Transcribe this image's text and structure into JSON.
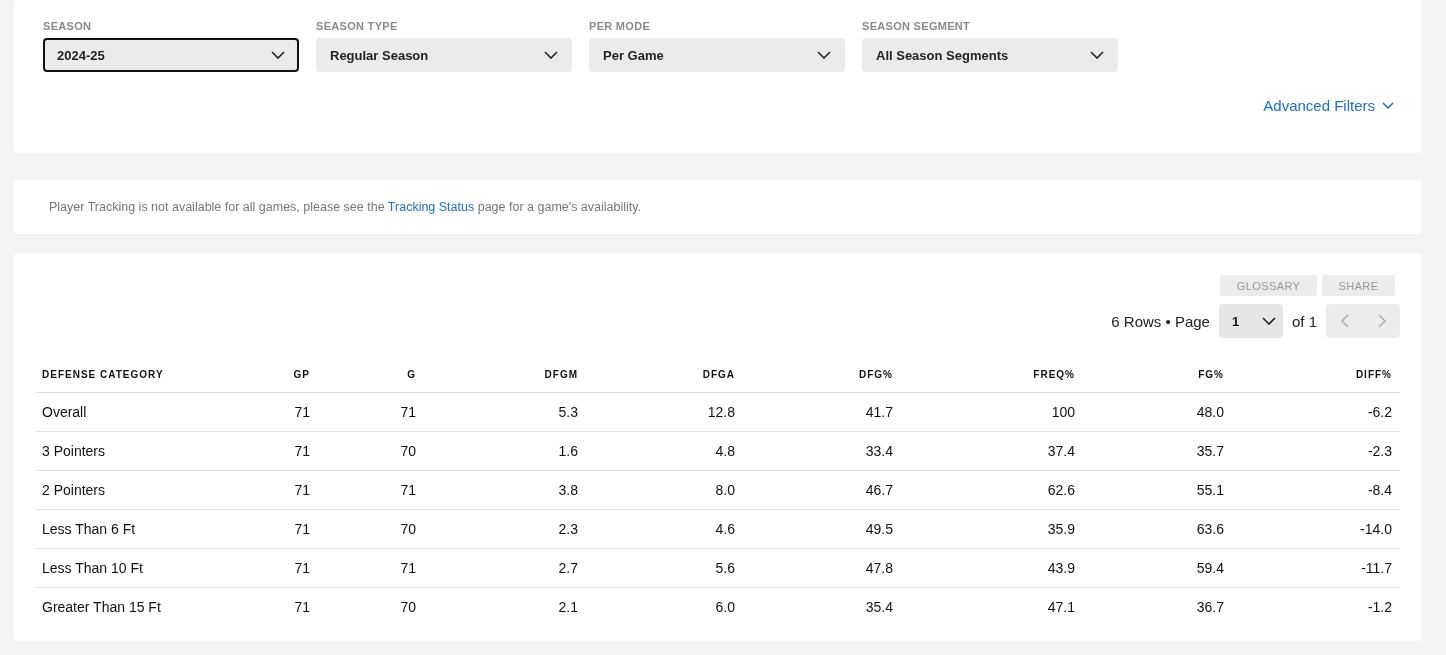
{
  "filters": [
    {
      "label": "SEASON",
      "value": "2024-25",
      "focused": true
    },
    {
      "label": "SEASON TYPE",
      "value": "Regular Season",
      "focused": false
    },
    {
      "label": "PER MODE",
      "value": "Per Game",
      "focused": false
    },
    {
      "label": "SEASON SEGMENT",
      "value": "All Season Segments",
      "focused": false
    }
  ],
  "advanced_filters": "Advanced Filters",
  "notice": {
    "before": "Player Tracking is not available for all games, please see the",
    "link": "Tracking Status",
    "after": "page for a game's availability."
  },
  "toolbar": {
    "buttons": [
      "GLOSSARY",
      "SHARE"
    ],
    "rows_label": "6 Rows • Page",
    "page": "1",
    "of_label": "of 1"
  },
  "table": {
    "columns": [
      "DEFENSE CATEGORY",
      "GP",
      "G",
      "DFGM",
      "DFGA",
      "DFG%",
      "FREQ%",
      "FG%",
      "DIFF%"
    ],
    "rows": [
      [
        "Overall",
        "71",
        "71",
        "5.3",
        "12.8",
        "41.7",
        "100",
        "48.0",
        "-6.2"
      ],
      [
        "3 Pointers",
        "71",
        "70",
        "1.6",
        "4.8",
        "33.4",
        "37.4",
        "35.7",
        "-2.3"
      ],
      [
        "2 Pointers",
        "71",
        "71",
        "3.8",
        "8.0",
        "46.7",
        "62.6",
        "55.1",
        "-8.4"
      ],
      [
        "Less Than 6 Ft",
        "71",
        "70",
        "2.3",
        "4.6",
        "49.5",
        "35.9",
        "63.6",
        "-14.0"
      ],
      [
        "Less Than 10 Ft",
        "71",
        "71",
        "2.7",
        "5.6",
        "47.8",
        "43.9",
        "59.4",
        "-11.7"
      ],
      [
        "Greater Than 15 Ft",
        "71",
        "70",
        "2.1",
        "6.0",
        "35.4",
        "47.1",
        "36.7",
        "-1.2"
      ]
    ]
  }
}
